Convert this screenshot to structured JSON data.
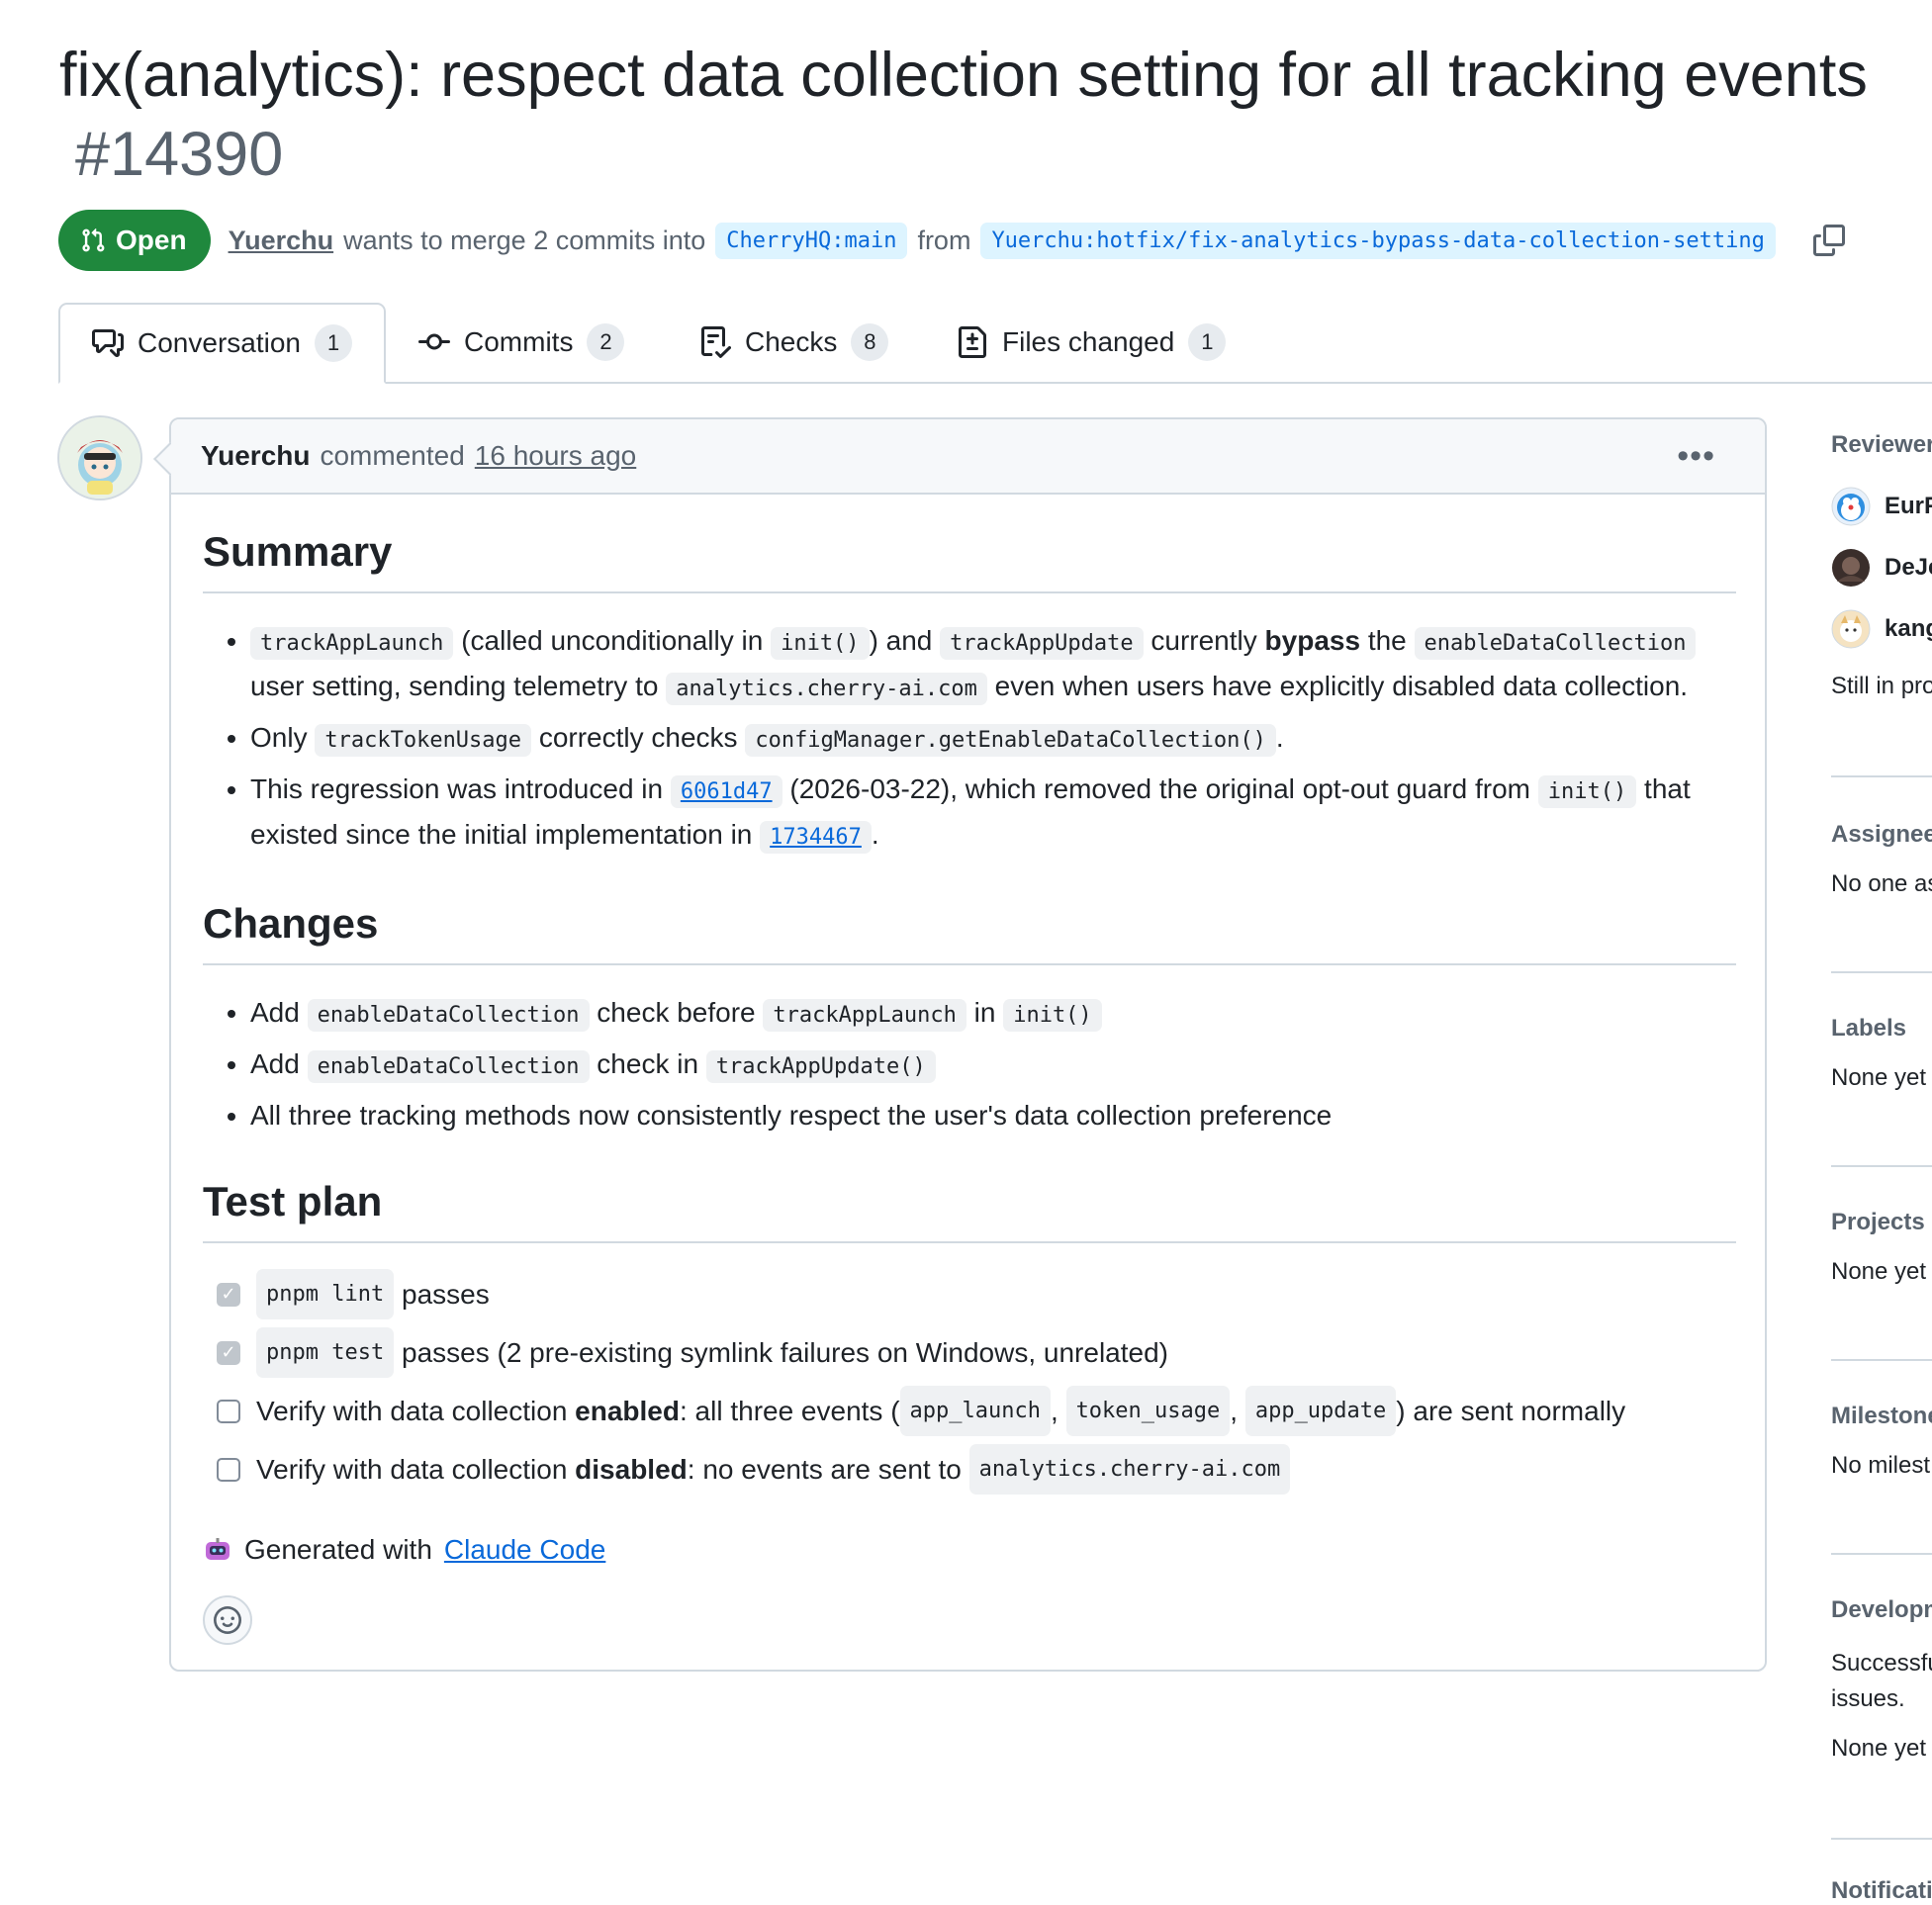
{
  "pr": {
    "title": "fix(analytics): respect data collection setting for all tracking events",
    "number": "#14390",
    "state": "Open",
    "author": "Yuerchu",
    "merge_text": "wants to merge 2 commits into",
    "base_branch": "CherryHQ:main",
    "from_text": "from",
    "head_branch": "Yuerchu:hotfix/fix-analytics-bypass-data-collection-setting"
  },
  "tabs": [
    {
      "label": "Conversation",
      "count": "1",
      "icon": "comment-discussion-icon"
    },
    {
      "label": "Commits",
      "count": "2",
      "icon": "git-commit-icon"
    },
    {
      "label": "Checks",
      "count": "8",
      "icon": "checklist-icon"
    },
    {
      "label": "Files changed",
      "count": "1",
      "icon": "file-diff-icon"
    }
  ],
  "comment": {
    "author": "Yuerchu",
    "action": "commented",
    "time": "16 hours ago",
    "summary": {
      "heading": "Summary",
      "b1": {
        "c1": "trackAppLaunch",
        "t1": "(called unconditionally in",
        "c2": "init()",
        "t2": ") and",
        "c3": "trackAppUpdate",
        "t3": "currently",
        "bold": "bypass",
        "t4": "the",
        "c4": "enableDataCollection",
        "t5": "user setting, sending telemetry to",
        "c5": "analytics.cherry-ai.com",
        "t6": "even when users have explicitly disabled data collection."
      },
      "b2": {
        "t1": "Only",
        "c1": "trackTokenUsage",
        "t2": "correctly checks",
        "c2": "configManager.getEnableDataCollection()",
        "t3": "."
      },
      "b3": {
        "t1": "This regression was introduced in",
        "c1": "6061d47",
        "t2": "(2026-03-22), which removed the original opt-out guard from",
        "c2": "init()",
        "t3": "that existed since the initial implementation in",
        "c3": "1734467",
        "t4": "."
      }
    },
    "changes": {
      "heading": "Changes",
      "b1": {
        "t1": "Add",
        "c1": "enableDataCollection",
        "t2": "check before",
        "c2": "trackAppLaunch",
        "t3": "in",
        "c3": "init()"
      },
      "b2": {
        "t1": "Add",
        "c1": "enableDataCollection",
        "t2": "check in",
        "c2": "trackAppUpdate()"
      },
      "b3": {
        "t1": "All three tracking methods now consistently respect the user's data collection preference"
      }
    },
    "test_plan": {
      "heading": "Test plan",
      "t1": {
        "c1": "pnpm lint",
        "t1": "passes",
        "checked": true
      },
      "t2": {
        "c1": "pnpm test",
        "t1": "passes (2 pre-existing symlink failures on Windows, unrelated)",
        "checked": true
      },
      "t3": {
        "t1": "Verify with data collection",
        "bold": "enabled",
        "t2": ": all three events (",
        "c1": "app_launch",
        "sep1": ",",
        "c2": "token_usage",
        "sep2": ",",
        "c3": "app_update",
        "t3": ") are sent normally",
        "checked": false
      },
      "t4": {
        "t1": "Verify with data collection",
        "bold": "disabled",
        "t2": ": no events are sent to",
        "c1": "analytics.cherry-ai.com",
        "checked": false
      }
    },
    "footer": {
      "text": "Generated with",
      "link": "Claude Code"
    }
  },
  "sidebar": {
    "reviewers": {
      "label": "Reviewers",
      "items": [
        "EurF",
        "DeJe",
        "kang"
      ],
      "status": "Still in pro"
    },
    "assignees": {
      "label": "Assignees",
      "value": "No one as"
    },
    "labels": {
      "label": "Labels",
      "value": "None yet"
    },
    "projects": {
      "label": "Projects",
      "value": "None yet"
    },
    "milestone": {
      "label": "Milestone",
      "value": "No milest"
    },
    "development": {
      "label": "Developm",
      "line1": "Successfu",
      "line2": "issues.",
      "value": "None yet"
    },
    "notifications": {
      "label": "Notificati"
    }
  },
  "colors": {
    "open_green": "#1f883d",
    "link_blue": "#0969da",
    "branch_bg": "#ddf4ff",
    "border": "#d1d9e0",
    "muted": "#59636e"
  }
}
